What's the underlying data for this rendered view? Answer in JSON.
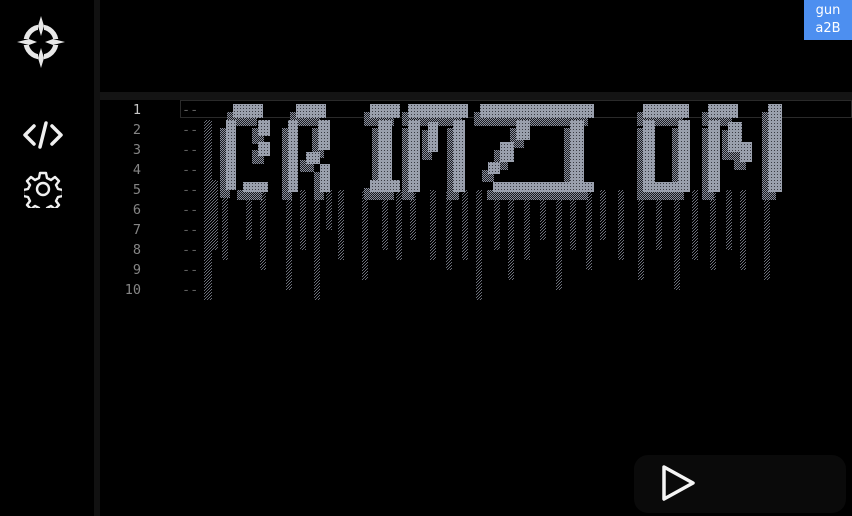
{
  "app": {
    "nav": {
      "items": [
        {
          "icon": "code-icon"
        },
        {
          "icon": "gear-icon"
        }
      ]
    },
    "badge": {
      "line1": "gun",
      "line2": "a2B",
      "color": "#4d8ff0"
    },
    "editor": {
      "active_line": 1,
      "lines": [
        {
          "number": "1",
          "text": "--"
        },
        {
          "number": "2",
          "text": "--"
        },
        {
          "number": "3",
          "text": "--"
        },
        {
          "number": "4",
          "text": "--"
        },
        {
          "number": "5",
          "text": "--"
        },
        {
          "number": "6",
          "text": "--"
        },
        {
          "number": "7",
          "text": "--"
        },
        {
          "number": "8",
          "text": "--"
        },
        {
          "number": "9",
          "text": "--"
        },
        {
          "number": "10",
          "text": "--"
        }
      ]
    },
    "run_button": {
      "icon": "play-icon"
    }
  }
}
